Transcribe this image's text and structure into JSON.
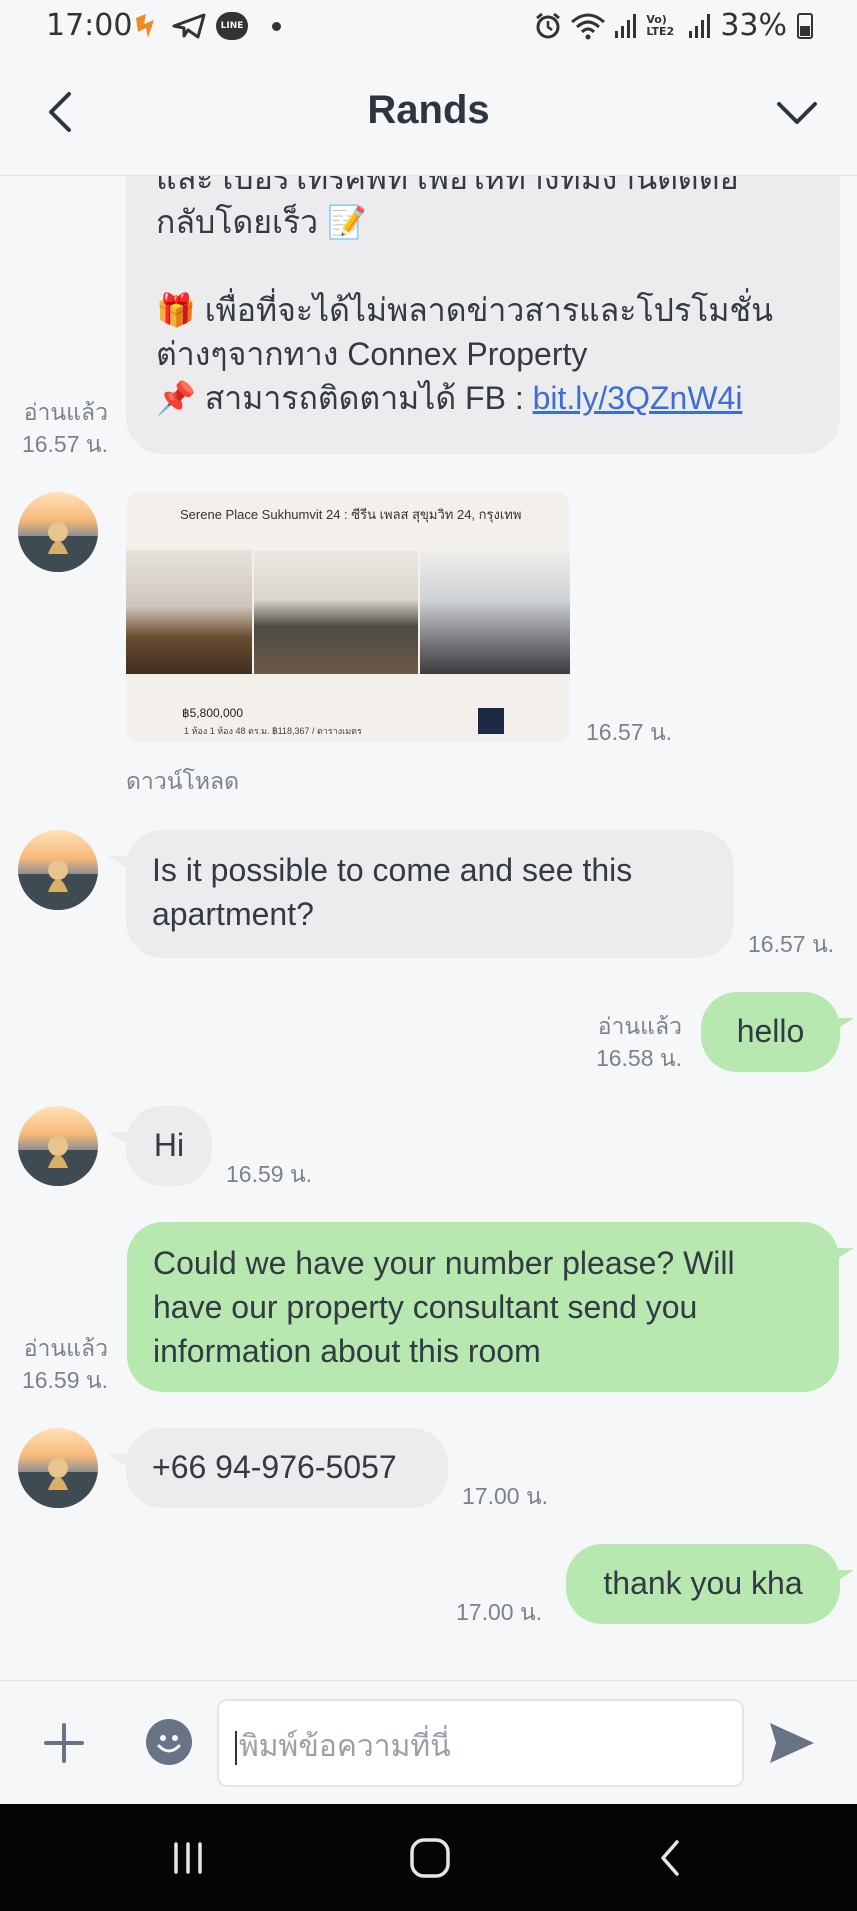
{
  "status_bar": {
    "time": "17:00",
    "line_icon_text": "LINE",
    "battery": "33%",
    "network_label": "Vo) LTE2"
  },
  "header": {
    "title": "Rands"
  },
  "messages": [
    {
      "id": "m1",
      "direction": "out",
      "lines": [
        "และ เบอร์โทรศัพท์ เพื่อให้ทางทีมงานติดต่อ",
        "กลับโดยเร็ว 📝",
        "",
        "🎁 เพื่อที่จะได้ไม่พลาดข่าวสารและโปรโมชั่น",
        "ต่างๆจากทาง Connex Property"
      ],
      "last_line_prefix": "📌 สามารถติดตามได้ FB : ",
      "link_text": "bit.ly/3QZnW4i",
      "read": "อ่านแล้ว",
      "time": "16.57 น."
    },
    {
      "id": "m2",
      "direction": "in",
      "type": "image",
      "image": {
        "title": "Serene Place Sukhumvit 24 : ซีรีน เพลส สุขุมวิท 24, กรุงเทพ",
        "price": "฿5,800,000",
        "sub": "1 ห้อง  1 ห้อง  48 ตร.ม.  ฿118,367 / ตารางเมตร"
      },
      "time": "16.57 น.",
      "download": "ดาวน์โหลด"
    },
    {
      "id": "m3",
      "direction": "in",
      "lines": [
        "Is it possible to come and see this",
        "apartment?"
      ],
      "time": "16.57 น."
    },
    {
      "id": "m4",
      "direction": "out",
      "text": "hello",
      "read": "อ่านแล้ว",
      "time": "16.58 น."
    },
    {
      "id": "m5",
      "direction": "in",
      "text": "Hi",
      "time": "16.59 น."
    },
    {
      "id": "m6",
      "direction": "out",
      "lines": [
        "Could we have your number please? Will",
        "have our property consultant send you",
        "information about this room"
      ],
      "read": "อ่านแล้ว",
      "time": "16.59 น."
    },
    {
      "id": "m7",
      "direction": "in",
      "text": "+66 94-976-5057",
      "time": "17.00 น."
    },
    {
      "id": "m8",
      "direction": "out",
      "text": "thank you kha",
      "time": "17.00 น."
    }
  ],
  "composer": {
    "placeholder": "พิมพ์ข้อความที่นี่"
  },
  "icons": {
    "back": "chevron-left-icon",
    "menu": "chevron-down-icon",
    "plus": "plus-icon",
    "emoji": "emoji-icon",
    "send": "send-icon",
    "nav_recents": "recents-icon",
    "nav_home": "home-icon",
    "nav_back": "nav-back-icon"
  },
  "colors": {
    "outgoing_bubble": "#b6e8af",
    "incoming_bubble": "#ececef",
    "link": "#3b6fd4",
    "background": "#f6f7f9"
  }
}
